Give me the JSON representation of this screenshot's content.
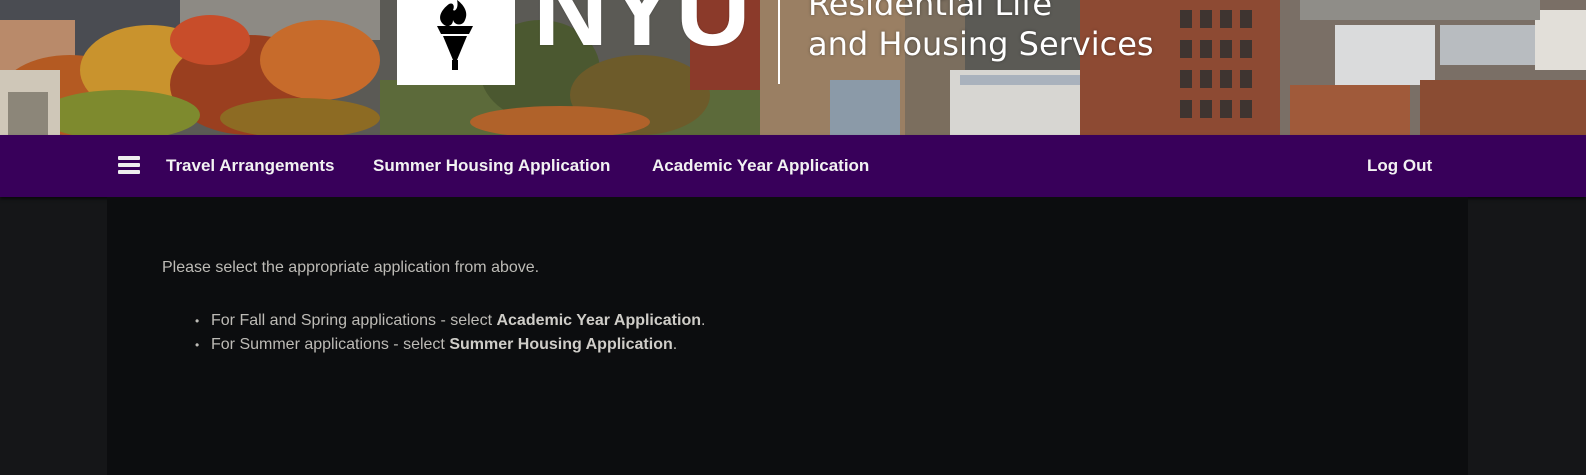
{
  "header": {
    "logo_word": "NYU",
    "department_line1": "Residential Life",
    "department_line2": "and Housing Services"
  },
  "nav": {
    "items": [
      {
        "label": "Travel Arrangements"
      },
      {
        "label": "Summer Housing Application"
      },
      {
        "label": "Academic Year Application"
      }
    ],
    "logout_label": "Log Out"
  },
  "main": {
    "intro": "Please select the appropriate application from above.",
    "instructions": [
      {
        "prefix": "For Fall and Spring applications - select ",
        "emphasis": "Academic Year Application",
        "suffix": "."
      },
      {
        "prefix": "For Summer applications - select ",
        "emphasis": "Summer Housing Application",
        "suffix": "."
      }
    ]
  },
  "icons": {
    "menu": "hamburger-menu-icon",
    "logo": "torch-icon",
    "bullet": "•"
  },
  "colors": {
    "nav_background": "#38005a",
    "nav_text": "#f2f2f2",
    "page_background": "#151618",
    "panel_background": "#0c0d0f",
    "body_text": "#bdbbb6"
  }
}
